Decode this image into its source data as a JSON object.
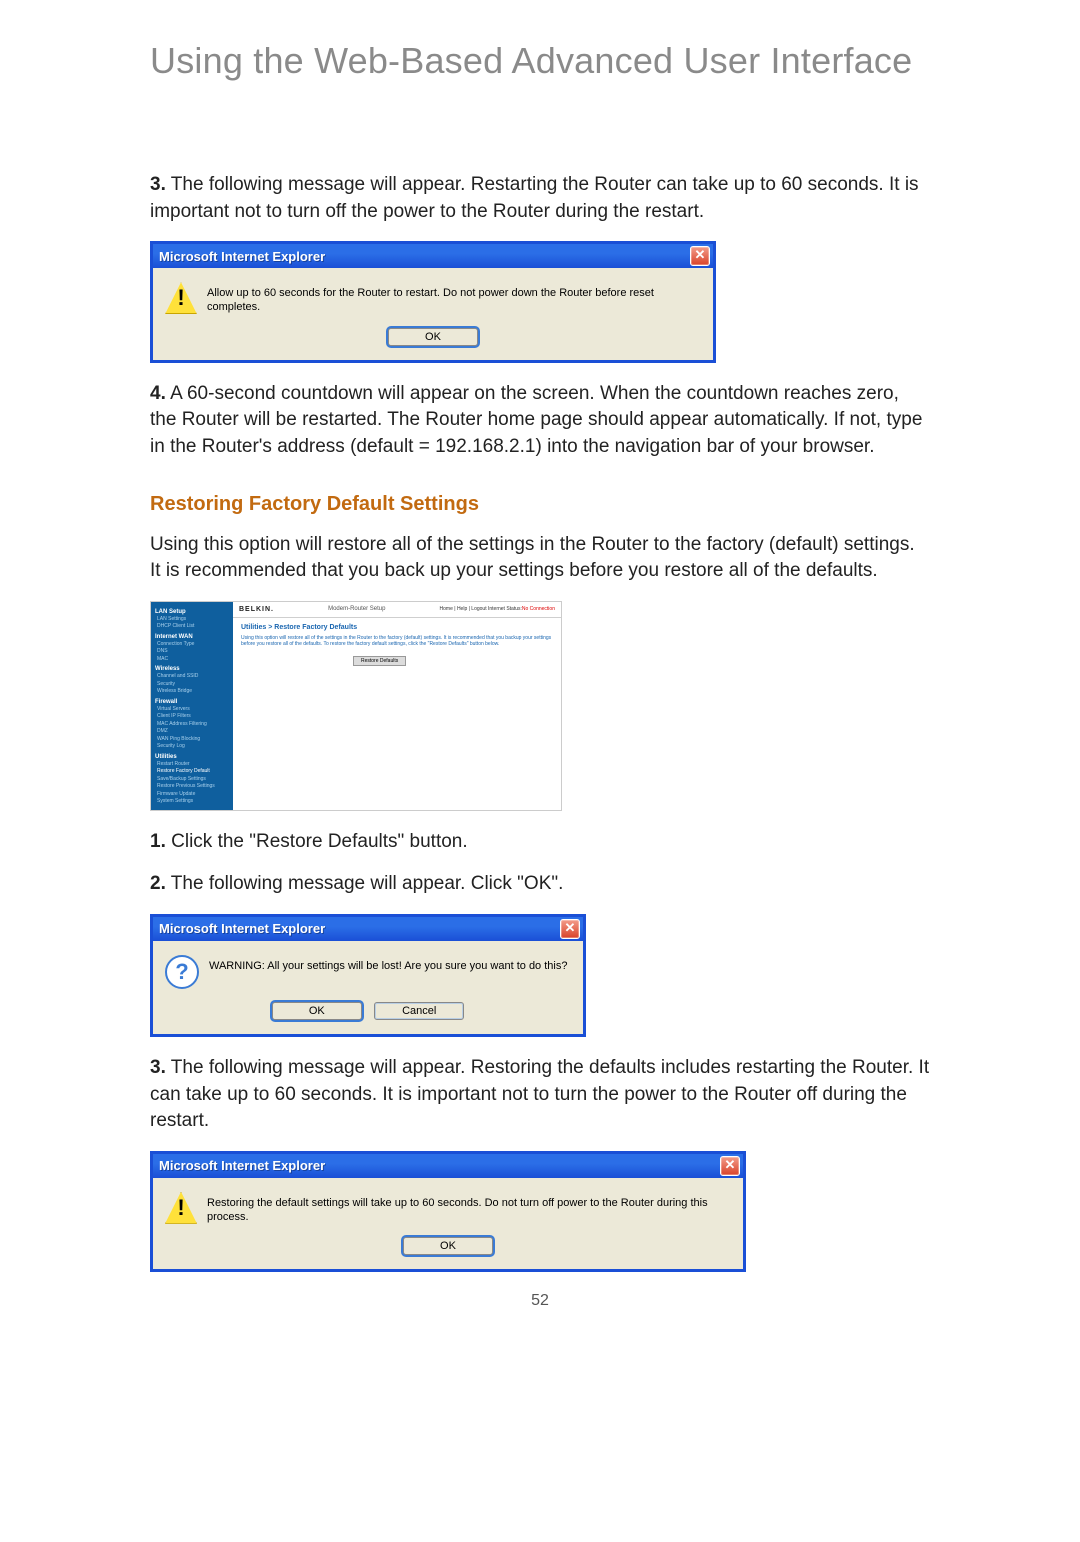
{
  "banner_title": "Using the Web-Based Advanced User Interface",
  "step3_text": " The following message will appear. Restarting the Router can take up to 60 seconds. It is important not to turn off the power to the Router during the restart.",
  "dialog1": {
    "title": "Microsoft Internet Explorer",
    "message": "Allow up to 60 seconds for the Router to restart. Do not power down the Router before reset completes.",
    "ok": "OK"
  },
  "step4_text": " A 60-second countdown will appear on the screen. When the countdown reaches zero, the Router will be restarted. The Router home page should appear automatically. If not, type in the Router's address (default = 192.168.2.1) into the navigation bar of your browser.",
  "section_heading": "Restoring Factory Default Settings",
  "section_intro": "Using this option will restore all of the settings in the Router to the factory (default) settings. It is recommended that you back up your settings before you restore all of the defaults.",
  "router_shot": {
    "logo": "BELKIN.",
    "product": "Modem-Router Setup",
    "toplinks_a": "Home | Help | Logout   Internet Status:",
    "toplinks_b": "No Connection",
    "heading": "Utilities > Restore Factory Defaults",
    "desc": "Using this option will restore all of the settings in the Router to the factory (default) settings. It is recommended that you backup your settings before you restore all of the defaults. To restore the factory default settings, click the \"Restore Defaults\" button below.",
    "button": "Restore Defaults",
    "sidebar": {
      "g1": "LAN Setup",
      "g1_items": [
        "LAN Settings",
        "DHCP Client List"
      ],
      "g2": "Internet WAN",
      "g2_items": [
        "Connection Type",
        "DNS",
        "MAC"
      ],
      "g3": "Wireless",
      "g3_items": [
        "Channel and SSID",
        "Security",
        "Wireless Bridge"
      ],
      "g4": "Firewall",
      "g4_items": [
        "Virtual Servers",
        "Client IP Filters",
        "MAC Address Filtering",
        "DMZ",
        "WAN Ping Blocking",
        "Security Log"
      ],
      "g5": "Utilities",
      "g5_items": [
        "Restart Router",
        "Restore Factory Default",
        "Save/Backup Settings",
        "Restore Previous Settings",
        "Firmware Update",
        "System Settings"
      ]
    }
  },
  "step1b_text": " Click the \"Restore Defaults\" button.",
  "step2b_text": " The following message will appear. Click \"OK\".",
  "dialog2": {
    "title": "Microsoft Internet Explorer",
    "message": "WARNING: All your settings will be lost! Are you sure you want to do this?",
    "ok": "OK",
    "cancel": "Cancel"
  },
  "step3b_text": " The following message will appear. Restoring the defaults includes restarting the Router. It can take up to 60 seconds. It is important not to turn the power to the Router off during the restart.",
  "dialog3": {
    "title": "Microsoft Internet Explorer",
    "message": "Restoring the default settings will take up to 60 seconds. Do not turn off power to the Router during this process.",
    "ok": "OK"
  },
  "page_number": "52",
  "labels": {
    "n3": "3.",
    "n4": "4.",
    "n1": "1.",
    "n2": "2."
  }
}
